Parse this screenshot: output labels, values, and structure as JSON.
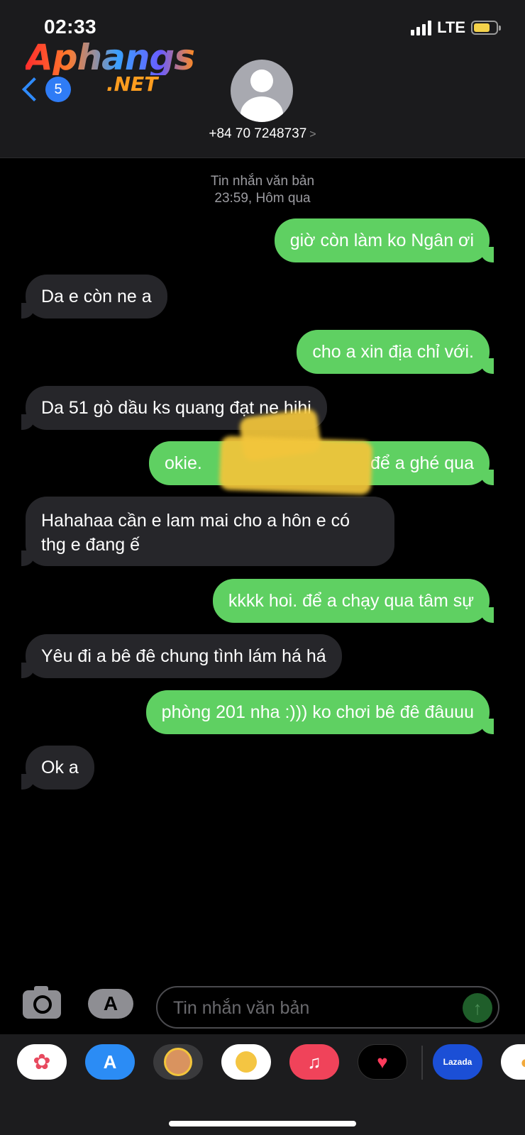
{
  "status": {
    "time": "02:33",
    "network": "LTE"
  },
  "logo": {
    "main": "Aphangs",
    "sub": ".NET"
  },
  "nav": {
    "back_count": "5"
  },
  "contact": {
    "number": "+84 70 7248737",
    "arrow": ">"
  },
  "thread": {
    "label": "Tin nhắn văn bản",
    "timestamp": "23:59, Hôm qua"
  },
  "messages": [
    {
      "from": "me",
      "text": "giờ còn làm ko Ngân ơi"
    },
    {
      "from": "them",
      "text": "Da e còn ne a"
    },
    {
      "from": "me",
      "text": "cho a xin địa chỉ với."
    },
    {
      "from": "them",
      "text": "Da 51 gò dầu ks quang đạt ne hihi"
    },
    {
      "from": "me",
      "text_start": "okie.",
      "text_end": "để a ghé qua",
      "redacted": true
    },
    {
      "from": "them",
      "text": "Hahahaa cần e lam mai cho a hôn e có thg e đang ế"
    },
    {
      "from": "me",
      "text": "kkkk hoi. để a chạy qua tâm sự"
    },
    {
      "from": "them",
      "text": "Yêu đi a bê đê chung tình lám há há"
    },
    {
      "from": "me",
      "text": "phòng 201 nha :))) ko chơi bê đê đâuuu"
    },
    {
      "from": "them",
      "text": "Ok a"
    }
  ],
  "input": {
    "placeholder": "Tin nhắn văn bản"
  },
  "apps": [
    {
      "name": "photos-icon"
    },
    {
      "name": "app-store-icon"
    },
    {
      "name": "memoji-icon"
    },
    {
      "name": "animoji-stickers-icon"
    },
    {
      "name": "music-icon"
    },
    {
      "name": "digital-touch-icon"
    },
    {
      "name": "lazada-icon",
      "label": "Lazada"
    },
    {
      "name": "maps-icon"
    }
  ],
  "colors": {
    "sent": "#5fd062",
    "received": "#26262a",
    "accent": "#2f7cf6"
  }
}
